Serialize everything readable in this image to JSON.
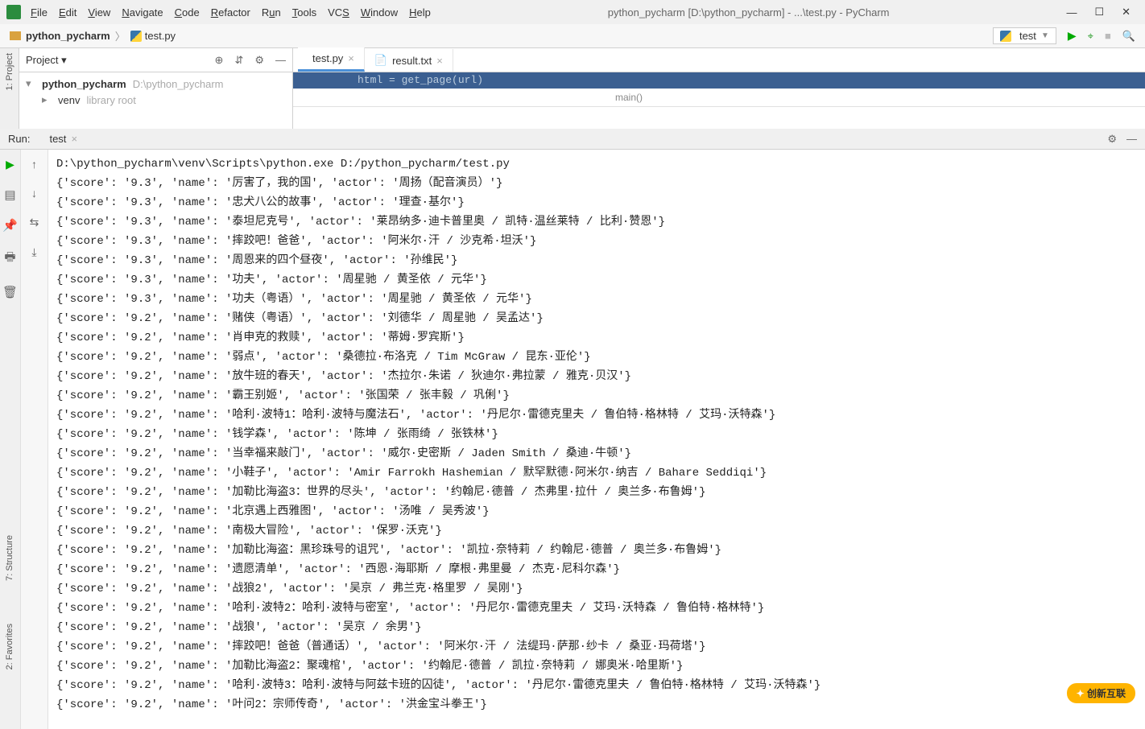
{
  "window": {
    "title": "python_pycharm [D:\\python_pycharm] - ...\\test.py - PyCharm"
  },
  "menubar": [
    "File",
    "Edit",
    "View",
    "Navigate",
    "Code",
    "Refactor",
    "Run",
    "Tools",
    "VCS",
    "Window",
    "Help"
  ],
  "breadcrumb": {
    "root": "python_pycharm",
    "file": "test.py"
  },
  "run_config": {
    "name": "test"
  },
  "project": {
    "title": "Project",
    "root": "python_pycharm",
    "root_path": "D:\\python_pycharm",
    "venv": "venv",
    "venv_hint": "library root"
  },
  "editor_tabs": [
    {
      "label": "test.py",
      "active": true
    },
    {
      "label": "result.txt",
      "active": false
    }
  ],
  "code_glimpse": "html = get_page(url)",
  "code_breadcrumb": "main()",
  "run_panel": {
    "label": "Run:",
    "tab": "test"
  },
  "console": {
    "cmd": "D:\\python_pycharm\\venv\\Scripts\\python.exe D:/python_pycharm/test.py",
    "lines": [
      "{'score': '9.3', 'name': '厉害了，我的国', 'actor': '周扬（配音演员）'}",
      "{'score': '9.3', 'name': '忠犬八公的故事', 'actor': '理查·基尔'}",
      "{'score': '9.3', 'name': '泰坦尼克号', 'actor': '莱昂纳多·迪卡普里奥 / 凯特·温丝莱特 / 比利·赞恩'}",
      "{'score': '9.3', 'name': '摔跤吧！爸爸', 'actor': '阿米尔·汗 / 沙克希·坦沃'}",
      "{'score': '9.3', 'name': '周恩来的四个昼夜', 'actor': '孙维民'}",
      "{'score': '9.3', 'name': '功夫', 'actor': '周星驰 / 黄圣依 / 元华'}",
      "{'score': '9.3', 'name': '功夫（粤语）', 'actor': '周星驰 / 黄圣依 / 元华'}",
      "{'score': '9.2', 'name': '赌侠（粤语）', 'actor': '刘德华 / 周星驰 / 吴孟达'}",
      "{'score': '9.2', 'name': '肖申克的救赎', 'actor': '蒂姆·罗宾斯'}",
      "{'score': '9.2', 'name': '弱点', 'actor': '桑德拉·布洛克 / Tim McGraw / 昆东·亚伦'}",
      "{'score': '9.2', 'name': '放牛班的春天', 'actor': '杰拉尔·朱诺 / 狄迪尔·弗拉蒙 / 雅克·贝汉'}",
      "{'score': '9.2', 'name': '霸王别姬', 'actor': '张国荣 / 张丰毅 / 巩俐'}",
      "{'score': '9.2', 'name': '哈利·波特1：哈利·波特与魔法石', 'actor': '丹尼尔·雷德克里夫 / 鲁伯特·格林特 / 艾玛·沃特森'}",
      "{'score': '9.2', 'name': '钱学森', 'actor': '陈坤 / 张雨绮 / 张铁林'}",
      "{'score': '9.2', 'name': '当幸福来敲门', 'actor': '威尔·史密斯 / Jaden Smith / 桑迪·牛顿'}",
      "{'score': '9.2', 'name': '小鞋子', 'actor': 'Amir Farrokh Hashemian / 默罕默德·阿米尔·纳吉 / Bahare Seddiqi'}",
      "{'score': '9.2', 'name': '加勒比海盗3：世界的尽头', 'actor': '约翰尼·德普 / 杰弗里·拉什 / 奥兰多·布鲁姆'}",
      "{'score': '9.2', 'name': '北京遇上西雅图', 'actor': '汤唯 / 吴秀波'}",
      "{'score': '9.2', 'name': '南极大冒险', 'actor': '保罗·沃克'}",
      "{'score': '9.2', 'name': '加勒比海盗：黑珍珠号的诅咒', 'actor': '凯拉·奈特莉 / 约翰尼·德普 / 奥兰多·布鲁姆'}",
      "{'score': '9.2', 'name': '遗愿清单', 'actor': '西恩·海耶斯 / 摩根·弗里曼 / 杰克·尼科尔森'}",
      "{'score': '9.2', 'name': '战狼2', 'actor': '吴京 / 弗兰克·格里罗 / 吴刚'}",
      "{'score': '9.2', 'name': '哈利·波特2：哈利·波特与密室', 'actor': '丹尼尔·雷德克里夫 / 艾玛·沃特森 / 鲁伯特·格林特'}",
      "{'score': '9.2', 'name': '战狼', 'actor': '吴京 / 余男'}",
      "{'score': '9.2', 'name': '摔跤吧！爸爸（普通话）', 'actor': '阿米尔·汗 / 法缇玛·萨那·纱卡 / 桑亚·玛荷塔'}",
      "{'score': '9.2', 'name': '加勒比海盗2：聚魂棺', 'actor': '约翰尼·德普 / 凯拉·奈特莉 / 娜奥米·哈里斯'}",
      "{'score': '9.2', 'name': '哈利·波特3：哈利·波特与阿兹卡班的囚徒', 'actor': '丹尼尔·雷德克里夫 / 鲁伯特·格林特 / 艾玛·沃特森'}",
      "{'score': '9.2', 'name': '叶问2：宗师传奇', 'actor': '洪金宝斗拳王'}"
    ]
  },
  "left_tabs": {
    "project": "1: Project",
    "structure": "7: Structure",
    "favorites": "2: Favorites"
  },
  "watermark": "创新互联"
}
